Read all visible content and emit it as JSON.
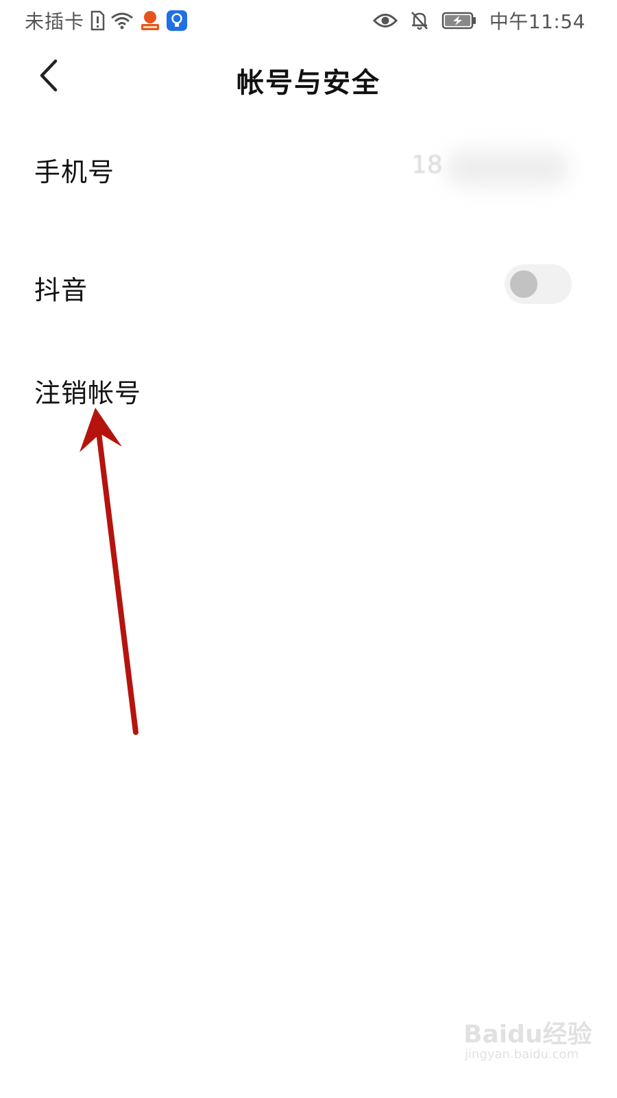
{
  "status_bar": {
    "carrier": "未插卡",
    "time": "中午11:54",
    "icons": [
      "sim-alert-icon",
      "wifi-icon",
      "app-notification-icon",
      "lightbulb-app-icon",
      "eye-icon",
      "bell-muted-icon",
      "battery-charging-icon"
    ]
  },
  "header": {
    "title": "帐号与安全",
    "back_icon": "chevron-left-icon"
  },
  "settings": {
    "phone": {
      "label": "手机号",
      "value": "18"
    },
    "douyin": {
      "label": "抖音",
      "toggle_on": false
    },
    "delete_account": {
      "label": "注销帐号"
    }
  },
  "annotation": {
    "color": "#b5140e",
    "points_to": "delete_account"
  },
  "watermark": {
    "brand": "Baidu经验",
    "url": "jingyan.baidu.com"
  }
}
